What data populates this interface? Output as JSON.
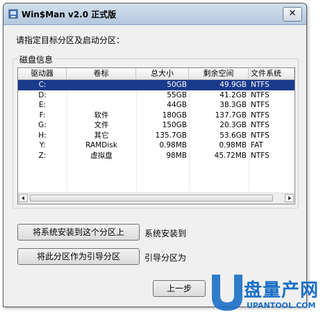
{
  "window": {
    "title": "Win$Man v2.0 正式版",
    "close_glyph": "✕"
  },
  "prompt": "请指定目标分区及启动分区：",
  "group": {
    "label": "磁盘信息"
  },
  "table": {
    "columns": [
      "驱动器",
      "卷标",
      "总大小",
      "剩余空间",
      "文件系统"
    ],
    "rows": [
      {
        "drive": "C:",
        "label": "",
        "total": "50GB",
        "free": "49.9GB",
        "fs": "NTFS",
        "selected": true
      },
      {
        "drive": "D:",
        "label": "",
        "total": "55GB",
        "free": "41.2GB",
        "fs": "NTFS"
      },
      {
        "drive": "E:",
        "label": "",
        "total": "44GB",
        "free": "38.3GB",
        "fs": "NTFS"
      },
      {
        "drive": "F:",
        "label": "软件",
        "total": "180GB",
        "free": "137.7GB",
        "fs": "NTFS"
      },
      {
        "drive": "G:",
        "label": "文件",
        "total": "150GB",
        "free": "20.3GB",
        "fs": "NTFS"
      },
      {
        "drive": "H:",
        "label": "其它",
        "total": "135.7GB",
        "free": "53.6GB",
        "fs": "NTFS"
      },
      {
        "drive": "Y:",
        "label": "RAMDisk",
        "total": "0.98MB",
        "free": "0.98MB",
        "fs": "FAT"
      },
      {
        "drive": "Z:",
        "label": "虚拟盘",
        "total": "98MB",
        "free": "45.72MB",
        "fs": "NTFS"
      }
    ]
  },
  "buttons": {
    "install_target": "将系统安装到这个分区上",
    "install_target_label": "系统安装到",
    "boot_target": "将此分区作为引导分区",
    "boot_target_label": "引导分区为",
    "back": "上一步"
  },
  "watermark": {
    "brand": "盘量产网",
    "url": "UPANTOOL.COM"
  },
  "colors": {
    "selection": "#1a3a8c",
    "watermark_blue": "#1a6fc7"
  }
}
